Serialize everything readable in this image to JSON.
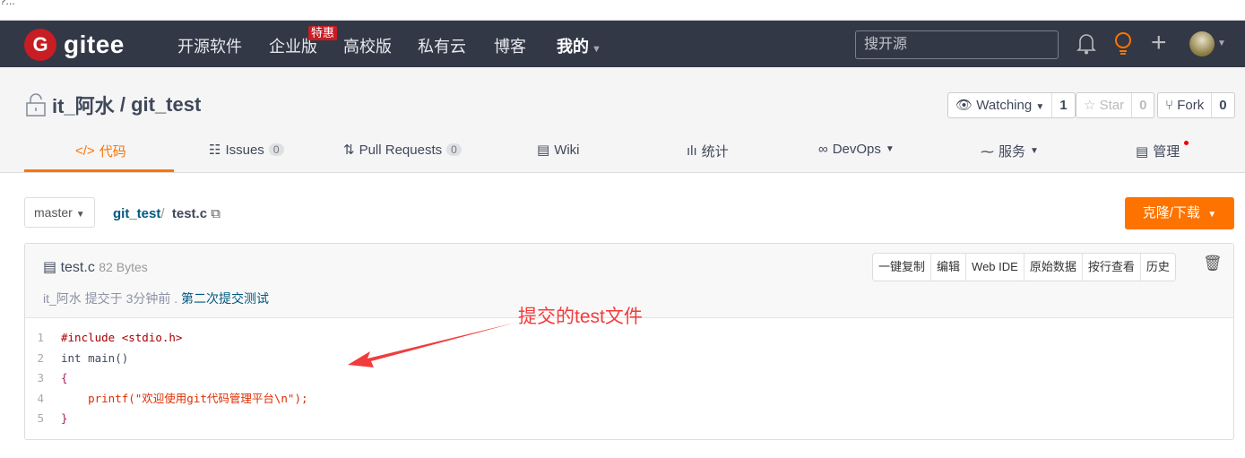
{
  "top_fragment": "?…",
  "nav": {
    "logo": "gitee",
    "logo_letter": "G",
    "items": [
      "开源软件",
      "企业版",
      "高校版",
      "私有云",
      "博客",
      "我的"
    ],
    "badge": "特惠",
    "search_placeholder": "搜开源",
    "accent": "#fe7300"
  },
  "repo": {
    "owner": "it_阿水",
    "sep": "/",
    "name": "git_test",
    "watch": {
      "label": "Watching",
      "count": "1"
    },
    "star": {
      "label": "Star",
      "count": "0"
    },
    "fork": {
      "label": "Fork",
      "count": "0"
    }
  },
  "tabs": [
    {
      "label": "代码"
    },
    {
      "label": "Issues",
      "count": "0"
    },
    {
      "label": "Pull Requests",
      "count": "0"
    },
    {
      "label": "Wiki"
    },
    {
      "label": "统计"
    },
    {
      "label": "DevOps"
    },
    {
      "label": "服务"
    },
    {
      "label": "管理"
    }
  ],
  "branch": "master",
  "breadcrumb": {
    "repo": "git_test",
    "sep": "/",
    "file": "test.c"
  },
  "clone_label": "克隆/下载",
  "file": {
    "name": "test.c",
    "size": "82 Bytes",
    "author": "it_阿水",
    "committed": "提交于 3分钟前 .",
    "message": "第二次提交测试",
    "actions": [
      "一键复制",
      "编辑",
      "Web IDE",
      "原始数据",
      "按行查看",
      "历史"
    ]
  },
  "code": [
    "#include <stdio.h>",
    "int main()",
    "{",
    "    printf(\"欢迎使用git代码管理平台\\n\");",
    "}"
  ],
  "annotation": "提交的test文件"
}
